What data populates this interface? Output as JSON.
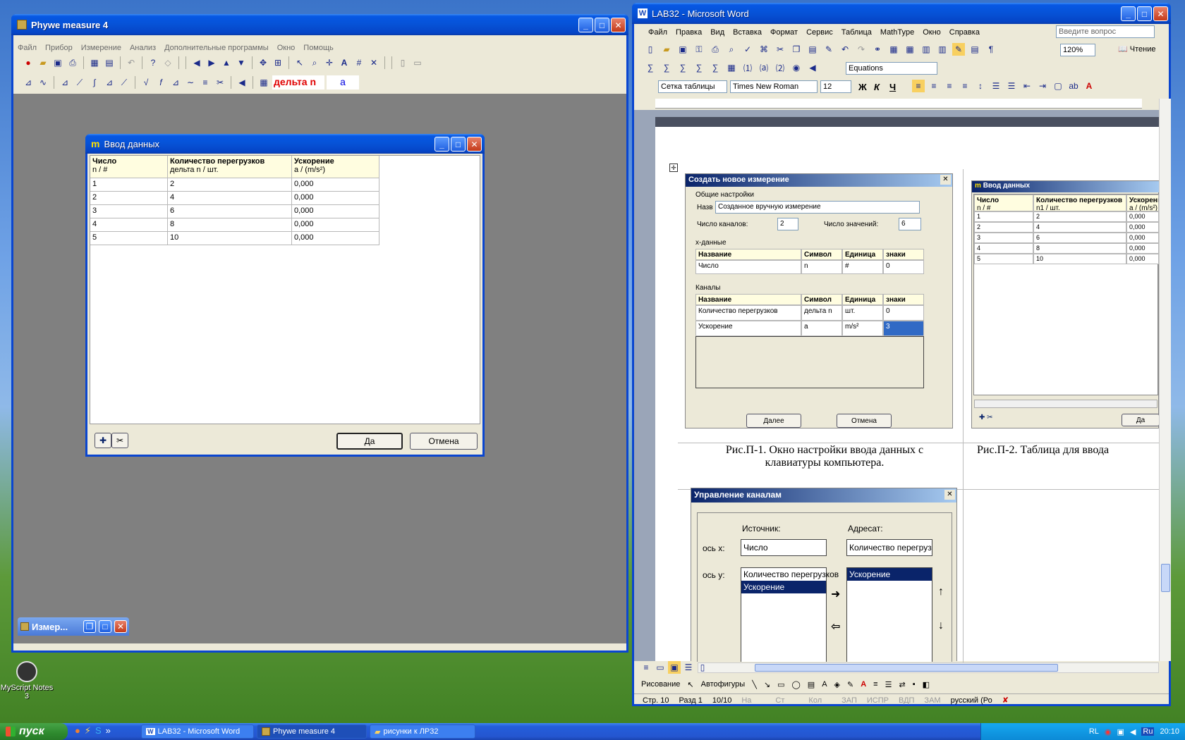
{
  "phywe": {
    "title": "Phywe measure 4",
    "menu": [
      "Файл",
      "Прибор",
      "Измерение",
      "Анализ",
      "Дополнительные программы",
      "Окно",
      "Помощь"
    ],
    "toolbar_labels": {
      "delta": "дельта n",
      "a": "a"
    },
    "minimized": "Измер..."
  },
  "data_dialog": {
    "title": "Ввод данных",
    "columns": [
      {
        "title": "Число",
        "sub": "n / #"
      },
      {
        "title": "Количество перегрузков",
        "sub": "дельта n / шт."
      },
      {
        "title": "Ускорение",
        "sub": "a / (m/s²)"
      }
    ],
    "rows": [
      [
        "1",
        "2",
        "0,000"
      ],
      [
        "2",
        "4",
        "0,000"
      ],
      [
        "3",
        "6",
        "0,000"
      ],
      [
        "4",
        "8",
        "0,000"
      ],
      [
        "5",
        "10",
        "0,000"
      ]
    ],
    "ok": "Да",
    "cancel": "Отмена"
  },
  "word": {
    "title": "LAB32 - Microsoft Word",
    "menu": [
      "Файл",
      "Правка",
      "Вид",
      "Вставка",
      "Формат",
      "Сервис",
      "Таблица",
      "MathType",
      "Окно",
      "Справка"
    ],
    "ask_placeholder": "Введите вопрос",
    "zoom": "120%",
    "read": "Чтение",
    "equations": "Equations",
    "style": "Сетка таблицы",
    "font": "Times New Roman",
    "size": "12",
    "bold": "Ж",
    "italic": "К",
    "underline": "Ч",
    "drawing": "Рисование",
    "autoshapes": "Автофигуры",
    "status": {
      "page": "Стр. 10",
      "section": "Разд 1",
      "pages": "10/10",
      "at": "На",
      "line": "Ст",
      "col": "Кол",
      "rec": "ЗАП",
      "trk": "ИСПР",
      "ext": "ВДП",
      "ovr": "ЗАМ",
      "lang": "русский (Ро"
    }
  },
  "new_measure": {
    "title": "Создать новое измерение",
    "general": "Общие настройки",
    "name_label": "Назв",
    "name_value": "Созданное вручную измерение",
    "channels_label": "Число каналов:",
    "channels_value": "2",
    "values_label": "Число значений:",
    "values_value": "6",
    "xdata": "x-данные",
    "headers": [
      "Название",
      "Символ",
      "Единица",
      "знаки"
    ],
    "x_row": [
      "Число",
      "n",
      "#",
      "0"
    ],
    "channels": "Каналы",
    "ch_rows": [
      [
        "Количество перегрузков",
        "дельта n",
        "шт.",
        "0"
      ],
      [
        "Ускорение",
        "a",
        "m/s²",
        "3"
      ]
    ],
    "next": "Далее",
    "cancel": "Отмена"
  },
  "thumb_table": {
    "title": "Ввод данных",
    "cols": [
      {
        "title": "Число",
        "sub": "n / #"
      },
      {
        "title": "Количество перегрузков",
        "sub": "n1 / шт."
      },
      {
        "title": "Ускорени",
        "sub": "a / (m/s²)"
      }
    ],
    "rows": [
      [
        "1",
        "2",
        "0,000"
      ],
      [
        "2",
        "4",
        "0,000"
      ],
      [
        "3",
        "6",
        "0,000"
      ],
      [
        "4",
        "8",
        "0,000"
      ],
      [
        "5",
        "10",
        "0,000"
      ]
    ],
    "ok": "Да"
  },
  "captions": {
    "fig1": "Рис.П-1. Окно настройки ввода данных с клавиатуры компьютера.",
    "fig2": "Рис.П-2. Таблица для ввода"
  },
  "channel_mgmt": {
    "title": "Управление каналам",
    "source": "Источник:",
    "target": "Адресат:",
    "xaxis": "ось x:",
    "yaxis": "ось y:",
    "x_source": "Число",
    "x_target": "Количество перегрузков",
    "y_source": [
      "Количество перегрузков",
      "Ускорение"
    ],
    "y_target": [
      "Ускорение"
    ]
  },
  "desktop": {
    "icon": "MyScript Notes 3"
  },
  "taskbar": {
    "start": "пуск",
    "tasks": [
      "LAB32 - Microsoft Word",
      "Phywe measure 4",
      "рисунки к ЛР32"
    ],
    "lang": "RL",
    "lang2": "Ru",
    "clock": "20:10"
  }
}
